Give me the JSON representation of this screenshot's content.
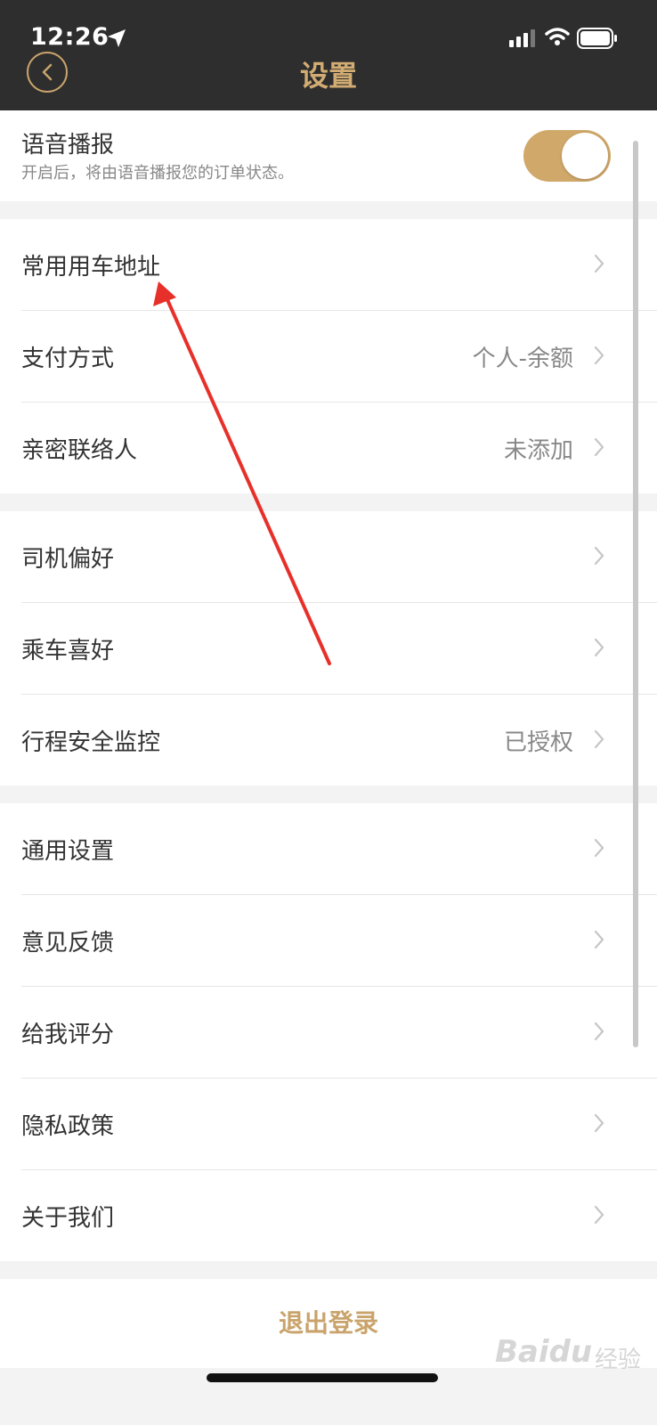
{
  "status_bar": {
    "time": "12:26"
  },
  "header": {
    "title": "设置"
  },
  "voice": {
    "title": "语音播报",
    "subtitle": "开启后，将由语音播报您的订单状态。",
    "enabled": true
  },
  "group1": [
    {
      "label": "常用用车地址",
      "value": ""
    },
    {
      "label": "支付方式",
      "value": "个人-余额"
    },
    {
      "label": "亲密联络人",
      "value": "未添加"
    }
  ],
  "group2": [
    {
      "label": "司机偏好",
      "value": ""
    },
    {
      "label": "乘车喜好",
      "value": ""
    },
    {
      "label": "行程安全监控",
      "value": "已授权"
    }
  ],
  "group3": [
    {
      "label": "通用设置",
      "value": ""
    },
    {
      "label": "意见反馈",
      "value": ""
    },
    {
      "label": "给我评分",
      "value": ""
    },
    {
      "label": "隐私政策",
      "value": ""
    },
    {
      "label": "关于我们",
      "value": ""
    }
  ],
  "logout": {
    "label": "退出登录"
  },
  "watermark": {
    "brand": "Baidu",
    "sub": "经验"
  },
  "colors": {
    "accent": "#d0a86a",
    "header_bg": "#2e2e2e",
    "arrow": "#e8302a"
  }
}
